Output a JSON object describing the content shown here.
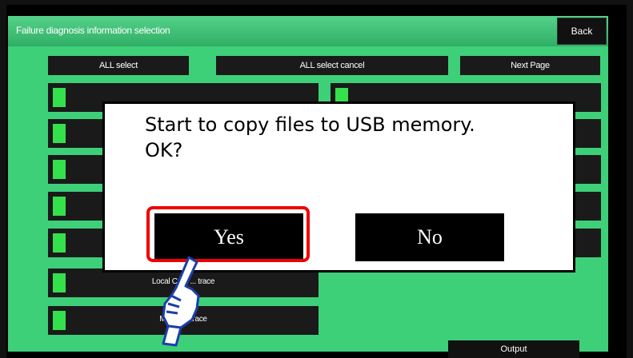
{
  "header": {
    "title": "Failure diagnosis information selection",
    "back_label": "Back"
  },
  "toolbar": {
    "all_select": "ALL select",
    "all_select_cancel": "ALL select cancel",
    "next_page": "Next Page"
  },
  "rows": [
    {
      "label": "Local CAN ... trace"
    },
    {
      "label": "Maker ... trace"
    }
  ],
  "dialog": {
    "line1": "Start to copy files to USB memory.",
    "line2": "OK?",
    "yes": "Yes",
    "no": "No"
  },
  "footer": {
    "output": "Output"
  },
  "colors": {
    "accent_green": "#3ecf79",
    "indicator_green": "#35e04d",
    "highlight_red": "#e00000"
  },
  "icons": {
    "pointer": "pointing-hand-icon"
  }
}
